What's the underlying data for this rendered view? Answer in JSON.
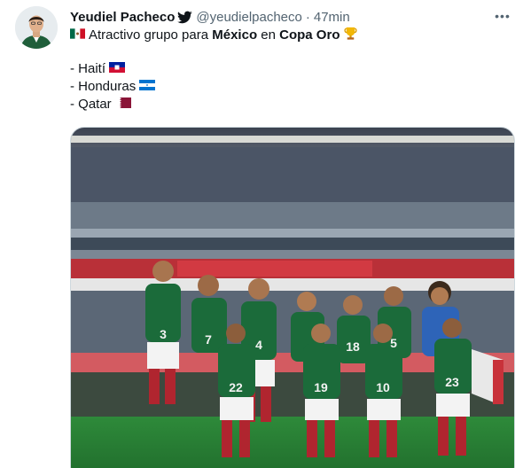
{
  "tweet": {
    "author": {
      "display_name": "Yeudiel Pacheco",
      "handle": "@yeudielpacheco",
      "separator": "·",
      "time": "47min",
      "verified_icon": "twitter-bird-icon"
    },
    "more_icon": "more-horizontal-icon",
    "more_label": "•••",
    "text": {
      "line1": {
        "flag_icon": "mexico-flag-icon",
        "pre": "Atractivo grupo para",
        "team": "México",
        "mid": "en",
        "cup": "Copa Oro",
        "trophy_icon": "trophy-icon"
      },
      "items": [
        {
          "label": "- Haití",
          "flag_icon": "haiti-flag-icon"
        },
        {
          "label": "- Honduras",
          "flag_icon": "honduras-flag-icon"
        },
        {
          "label": "- Qatar",
          "flag_icon": "qatar-flag-icon"
        }
      ]
    },
    "media": {
      "kind": "photo",
      "jerseys": [
        "3",
        "7",
        "4",
        "18",
        "5",
        "22",
        "19",
        "10",
        "23"
      ]
    },
    "colors": {
      "text": "#0f1419",
      "secondary": "#536471",
      "jersey_green": "#1b6b3a",
      "stadium_red": "#c8323a"
    }
  }
}
